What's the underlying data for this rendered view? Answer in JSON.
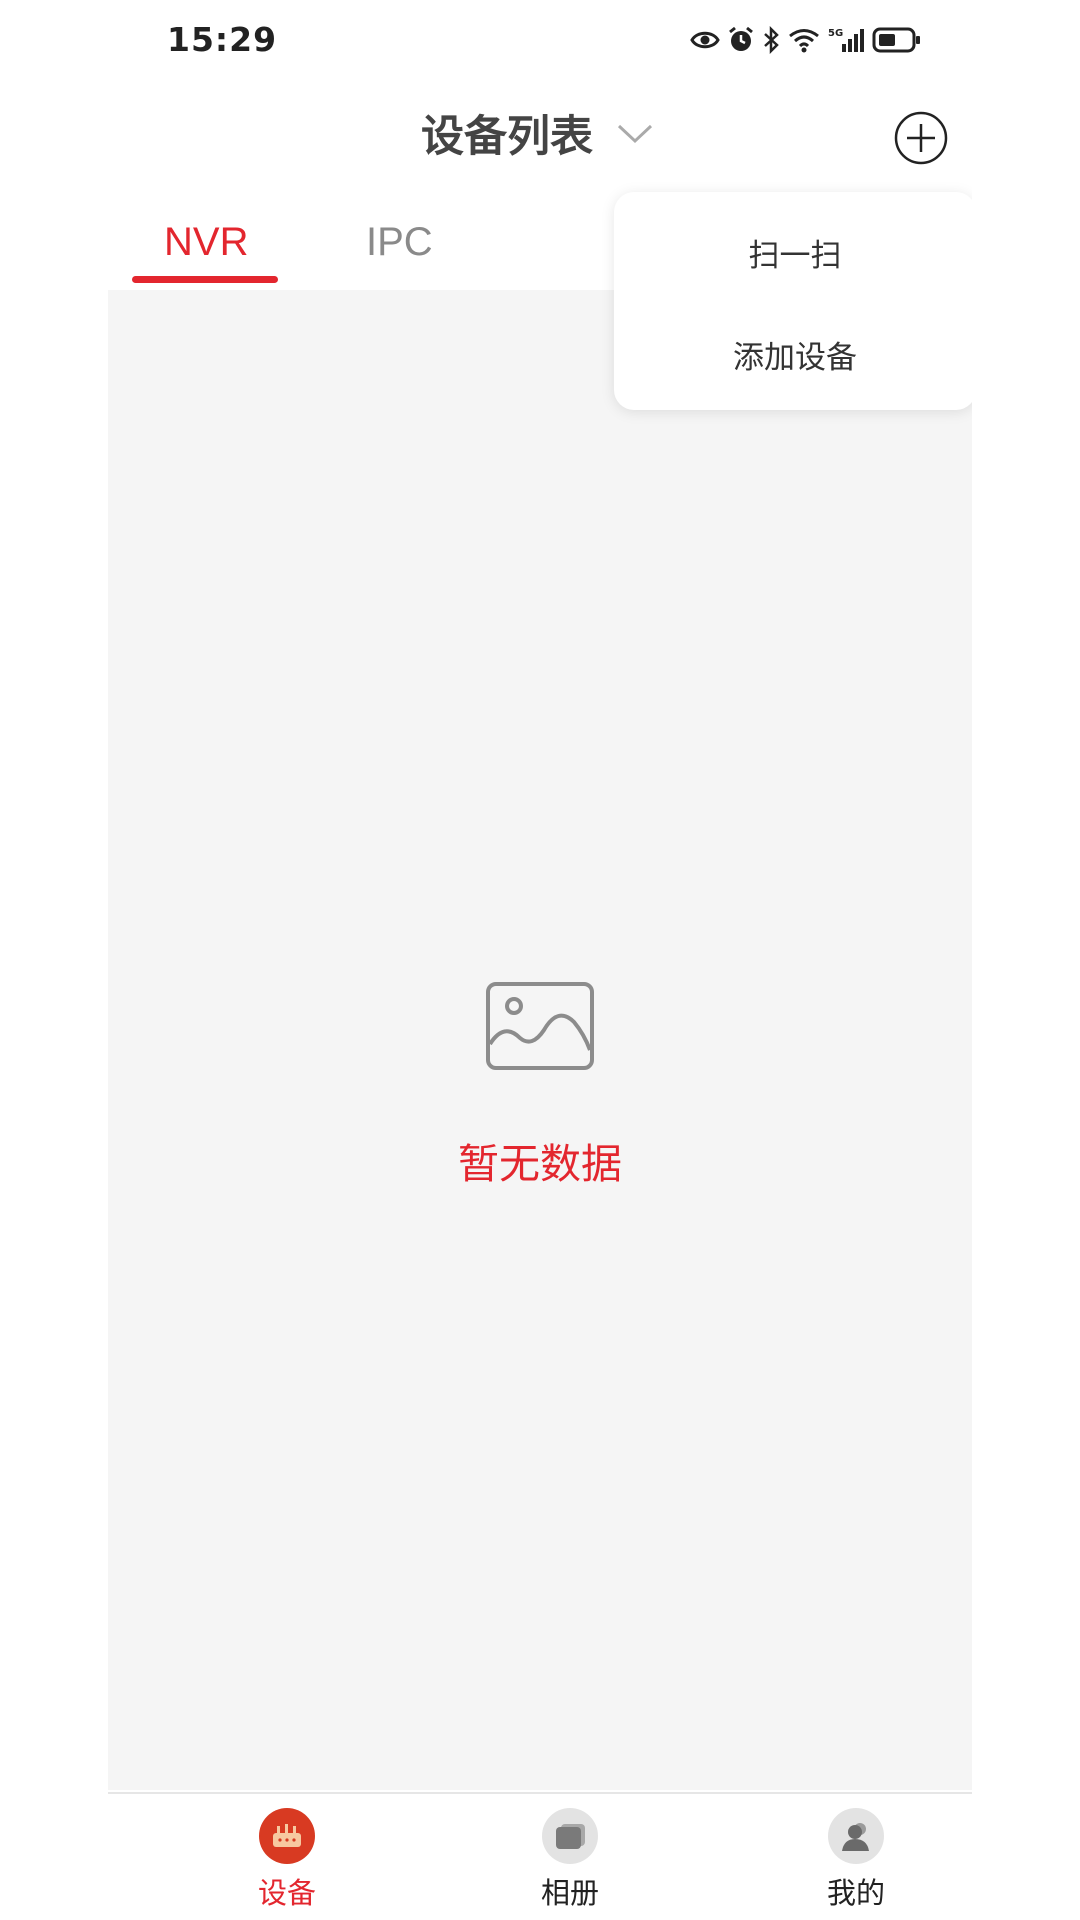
{
  "status_bar": {
    "time": "15:29",
    "icons": [
      "eye-icon",
      "alarm-icon",
      "bluetooth-icon",
      "wifi-icon",
      "signal-5g-icon",
      "battery-icon"
    ]
  },
  "header": {
    "title": "设备列表",
    "dropdown_icon": "chevron-down-icon",
    "add_icon": "plus-circle-icon"
  },
  "tabs": [
    {
      "label": "NVR",
      "active": true
    },
    {
      "label": "IPC",
      "active": false
    }
  ],
  "empty_state": {
    "icon": "image-placeholder-icon",
    "text": "暂无数据"
  },
  "popup_menu": {
    "items": [
      {
        "label": "扫一扫"
      },
      {
        "label": "添加设备"
      }
    ]
  },
  "bottom_nav": {
    "items": [
      {
        "label": "设备",
        "icon": "device-icon",
        "active": true
      },
      {
        "label": "相册",
        "icon": "album-icon",
        "active": false
      },
      {
        "label": "我的",
        "icon": "user-icon",
        "active": false
      }
    ]
  },
  "colors": {
    "accent": "#e3262e",
    "background": "#f5f5f5",
    "inactive_text": "#8a8a8a"
  }
}
